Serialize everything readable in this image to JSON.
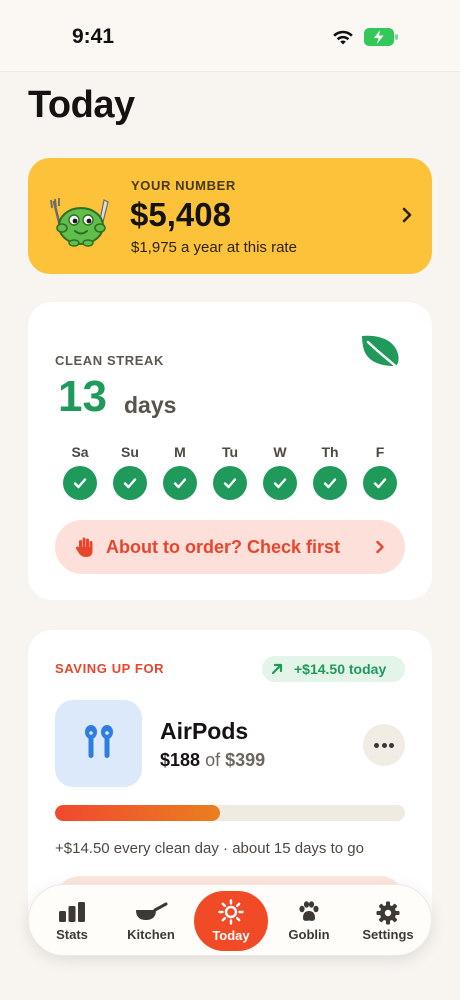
{
  "status_bar": {
    "time": "9:41"
  },
  "page_title": "Today",
  "number_card": {
    "label": "YOUR NUMBER",
    "value": "$5,408",
    "subtext": "$1,975 a year at this rate"
  },
  "streak_card": {
    "label": "CLEAN STREAK",
    "count": "13",
    "unit": "days",
    "days": [
      {
        "letter": "Sa",
        "done": true
      },
      {
        "letter": "Su",
        "done": true
      },
      {
        "letter": "M",
        "done": true
      },
      {
        "letter": "Tu",
        "done": true
      },
      {
        "letter": "W",
        "done": true
      },
      {
        "letter": "Th",
        "done": true
      },
      {
        "letter": "F",
        "done": true
      }
    ],
    "check_first_label": "About to order? Check first"
  },
  "saving_card": {
    "label": "SAVING UP FOR",
    "today_badge": "+$14.50 today",
    "product_name": "AirPods",
    "current": "$188",
    "of_text": "of",
    "goal": "$399",
    "progress_percent": 47,
    "note": "+$14.50 every clean day · about 15 days to go"
  },
  "tab_bar": {
    "tabs": [
      {
        "label": "Stats",
        "icon": "bar-chart-icon"
      },
      {
        "label": "Kitchen",
        "icon": "pan-icon"
      },
      {
        "label": "Today",
        "icon": "sun-icon",
        "active": true
      },
      {
        "label": "Goblin",
        "icon": "paw-icon"
      },
      {
        "label": "Settings",
        "icon": "gear-icon"
      }
    ]
  },
  "colors": {
    "accent_orange": "#f04a26",
    "green": "#1f9a5b",
    "yellow_card": "#fcc23a",
    "background": "#f8f5f1"
  }
}
